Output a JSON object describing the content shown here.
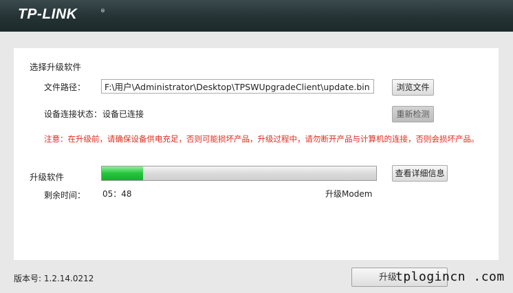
{
  "header": {
    "logo": "TP-LINK",
    "trademark": "®"
  },
  "upgrade": {
    "section_title": "选择升级软件",
    "file_path_label": "文件路径：",
    "file_path_value": "F:\\用户\\Administrator\\Desktop\\TPSWUpgradeClient\\update.bin",
    "browse_button": "浏览文件",
    "device_status_label": "设备连接状态：",
    "device_status_value": "设备已连接",
    "redetect_button": "重新检测",
    "warning": "注意：在升级前，请确保设备供电充足，否则可能损坏产品，升级过程中，请勿断开产品与计算机的连接，否则会损坏产品。"
  },
  "progress": {
    "label": "升级软件",
    "percent": 15,
    "details_button": "查看详细信息",
    "remaining_label": "剩余时间：",
    "remaining_value": "05：48",
    "status_text": "升级Modem"
  },
  "footer": {
    "version_label": "版本号:",
    "version_value": "1.2.14.0212",
    "upgrade_button": "升级"
  },
  "watermark": "tplogincn .com",
  "colors": {
    "warning": "#e02b20",
    "progress_fill": "#26c43d",
    "header_bg": "#243234"
  }
}
